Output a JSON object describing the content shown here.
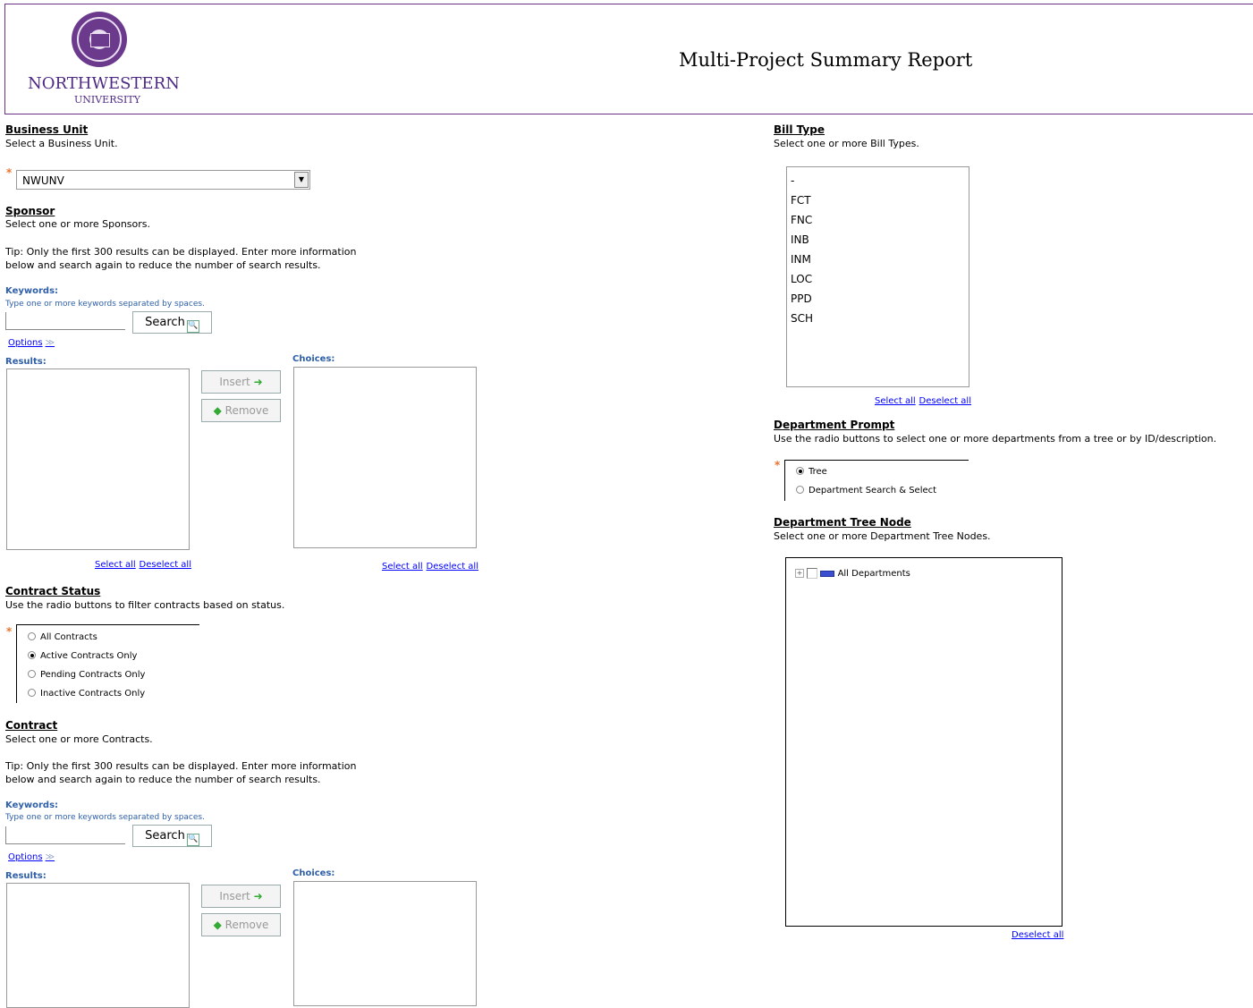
{
  "header": {
    "brand_line1": "NORTHWESTERN",
    "brand_line2": "UNIVERSITY",
    "title": "Multi-Project Summary Report"
  },
  "business_unit": {
    "heading": "Business Unit",
    "description": "Select a Business Unit.",
    "value": "NWUNV"
  },
  "sponsor": {
    "heading": "Sponsor",
    "description": "Select one or more Sponsors.",
    "tip": "Tip: Only the first 300 results can be displayed. Enter more information below and search again to reduce the number of search results.",
    "keywords_label": "Keywords:",
    "keywords_hint": "Type one or more keywords separated by spaces.",
    "search_label": "Search",
    "options_label": "Options",
    "results_label": "Results:",
    "choices_label": "Choices:",
    "insert_label": "Insert",
    "remove_label": "Remove",
    "select_all": "Select all",
    "deselect_all": "Deselect all"
  },
  "contract_status": {
    "heading": "Contract Status",
    "description": "Use the radio buttons to filter contracts based on status.",
    "options": [
      "All Contracts",
      "Active Contracts Only",
      "Pending Contracts Only",
      "Inactive Contracts Only"
    ],
    "selected": "Active Contracts Only"
  },
  "contract": {
    "heading": "Contract",
    "description": "Select one or more Contracts.",
    "tip": "Tip: Only the first 300 results can be displayed. Enter more information below and search again to reduce the number of search results.",
    "keywords_label": "Keywords:",
    "keywords_hint": "Type one or more keywords separated by spaces.",
    "search_label": "Search",
    "options_label": "Options",
    "results_label": "Results:",
    "choices_label": "Choices:",
    "insert_label": "Insert",
    "remove_label": "Remove"
  },
  "bill_type": {
    "heading": "Bill Type",
    "description": "Select one or more Bill Types.",
    "items": [
      "-",
      "FCT",
      "FNC",
      "INB",
      "INM",
      "LOC",
      "PPD",
      "SCH"
    ],
    "select_all": "Select all",
    "deselect_all": "Deselect all"
  },
  "department_prompt": {
    "heading": "Department Prompt",
    "description": "Use the radio buttons to select one or more departments from a tree or by ID/description.",
    "options": [
      "Tree",
      "Department Search & Select"
    ],
    "selected": "Tree"
  },
  "department_tree": {
    "heading": "Department Tree Node",
    "description": "Select one or more Department Tree Nodes.",
    "root_label": "All Departments",
    "deselect_all": "Deselect all"
  },
  "colors": {
    "brand_purple": "#4e2a84",
    "link_blue": "#0000ff",
    "label_blue": "#2e5fa8",
    "required_orange": "#e8742e"
  }
}
